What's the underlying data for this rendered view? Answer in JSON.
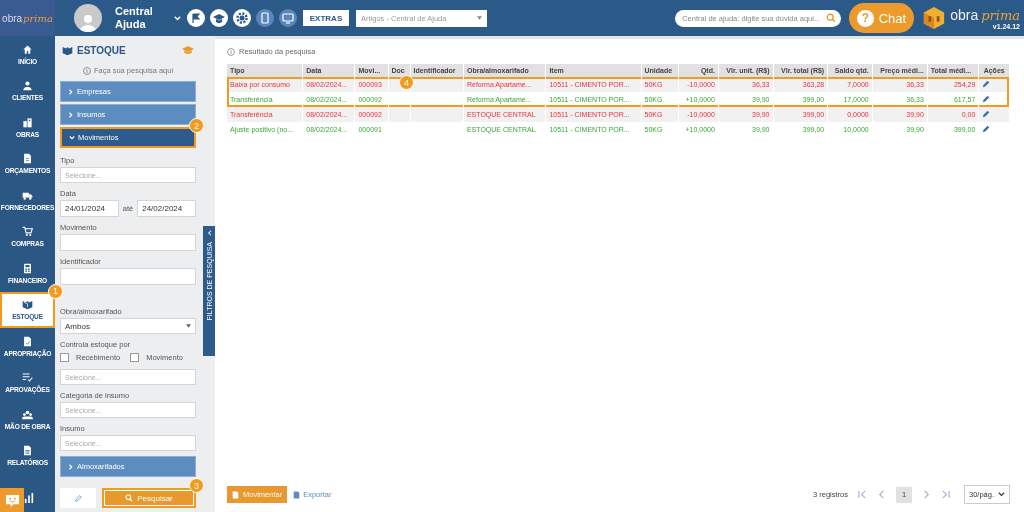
{
  "header": {
    "logo": {
      "part_1": "obra",
      "part_2": "prima"
    },
    "user_name": "Central Ajuda",
    "extras_button": "EXTRAS",
    "articles_select": "Artigos - Central de Ajuda",
    "help_search": {
      "placeholder": "Central de ajuda: digite sua dúvida aqui..."
    },
    "chat_button": {
      "icon": "?",
      "label": "Chat"
    },
    "brand": {
      "part_1": "obra",
      "part_2": "prima",
      "version": "v1.24.12"
    }
  },
  "nav": {
    "items": [
      {
        "label": "INÍCIO",
        "selected": false,
        "highlighted": false
      },
      {
        "label": "CLIENTES",
        "selected": false,
        "highlighted": false
      },
      {
        "label": "OBRAS",
        "selected": false,
        "highlighted": false
      },
      {
        "label": "ORÇAMENTOS",
        "selected": false,
        "highlighted": false
      },
      {
        "label": "FORNECEDORES",
        "selected": false,
        "highlighted": false
      },
      {
        "label": "COMPRAS",
        "selected": false,
        "highlighted": false
      },
      {
        "label": "FINANCEIRO",
        "selected": false,
        "highlighted": false
      },
      {
        "label": "ESTOQUE",
        "selected": true,
        "highlighted": true,
        "callout": "1"
      },
      {
        "label": "APROPRIAÇÃO",
        "selected": false,
        "highlighted": false
      },
      {
        "label": "APROVAÇÕES",
        "selected": false,
        "highlighted": false
      },
      {
        "label": "MÃO DE OBRA",
        "selected": false,
        "highlighted": false
      },
      {
        "label": "RELATÓRIOS",
        "selected": false,
        "highlighted": false
      }
    ]
  },
  "filters": {
    "title": "ESTOQUE",
    "hint": "Faça sua pesquisa aqui",
    "sections": [
      {
        "label": "Empresas",
        "expanded": false,
        "highlighted": false
      },
      {
        "label": "Insumos",
        "expanded": false,
        "highlighted": false
      },
      {
        "label": "Movimentos",
        "expanded": true,
        "highlighted": true,
        "callout": "2",
        "fields": [
          {
            "kind": "select",
            "label": "Tipo",
            "placeholder": "Selecione..."
          },
          {
            "kind": "date-range",
            "label": "Data",
            "from": "24/01/2024",
            "separator": "até",
            "to": "24/02/2024"
          },
          {
            "kind": "text",
            "label": "Movimento"
          },
          {
            "kind": "text",
            "label": "Identificador"
          },
          {
            "kind": "select",
            "label": "Obra/almoxarifado",
            "value": "Ambos",
            "gap": true
          },
          {
            "kind": "checkboxes",
            "label": "Controla estoque por",
            "options": [
              {
                "label": "Recebimento",
                "checked": false
              },
              {
                "label": "Movimento",
                "checked": false
              }
            ]
          },
          {
            "kind": "select",
            "placeholder": "Selecione..."
          },
          {
            "kind": "select",
            "label": "Categoria de insumo",
            "placeholder": "Selecione..."
          },
          {
            "kind": "select",
            "label": "Insumo",
            "placeholder": "Selecione..."
          }
        ]
      },
      {
        "label": "Almoxarifados",
        "expanded": false,
        "highlighted": false
      }
    ],
    "search_button": {
      "label": "Pesquisar",
      "highlighted": true,
      "callout": "3"
    },
    "collapse_handle": "FILTROS DE PESQUISA"
  },
  "results": {
    "title": "Resultado da pesquisa",
    "table": {
      "callout": "4",
      "columns": [
        "Tipo",
        "Data",
        "Movi...",
        "Doc",
        "Identificador",
        "Obra/almoxarifado",
        "Item",
        "Unidade",
        "Qtd.",
        "Vlr. unit. (R$)",
        "Vlr. total (R$)",
        "Saldo qtd.",
        "Preço médi...",
        "Total médi...",
        "Ações"
      ],
      "rows": [
        {
          "kind": "outflow",
          "highlighted": true,
          "cells": [
            "Baixa por consumo",
            "08/02/2024...",
            "000093",
            "",
            "",
            "Reforma Apartame...",
            "10511 - CIMENTO POR...",
            "50KG",
            "-10,0000",
            "36,33",
            "363,28",
            "7,0000",
            "36,33",
            "254,29"
          ]
        },
        {
          "kind": "inflow",
          "highlighted": true,
          "cells": [
            "Transferência",
            "08/02/2024...",
            "000092",
            "",
            "",
            "Reforma Apartame...",
            "10511 - CIMENTO POR...",
            "50KG",
            "+10,0000",
            "39,90",
            "399,00",
            "17,0000",
            "36,33",
            "617,57"
          ]
        },
        {
          "kind": "outflow",
          "highlighted": false,
          "cells": [
            "Transferência",
            "08/02/2024...",
            "000092",
            "",
            "",
            "ESTOQUE CENTRAL",
            "10511 - CIMENTO POR...",
            "50KG",
            "-10,0000",
            "39,90",
            "399,00",
            "0,0000",
            "39,90",
            "0,00"
          ]
        },
        {
          "kind": "inflow",
          "highlighted": false,
          "cells": [
            "Ajuste positivo (no...",
            "08/02/2024...",
            "000091",
            "",
            "",
            "ESTOQUE CENTRAL",
            "10511 - CIMENTO POR...",
            "50KG",
            "+10,0000",
            "39,90",
            "399,00",
            "10,0000",
            "39,90",
            "399,00"
          ]
        }
      ]
    },
    "footer": {
      "move_button": "Movimentar",
      "export_link": "Exportar",
      "count": "3 registros",
      "current_page": "1",
      "page_size": "30/pág."
    }
  }
}
